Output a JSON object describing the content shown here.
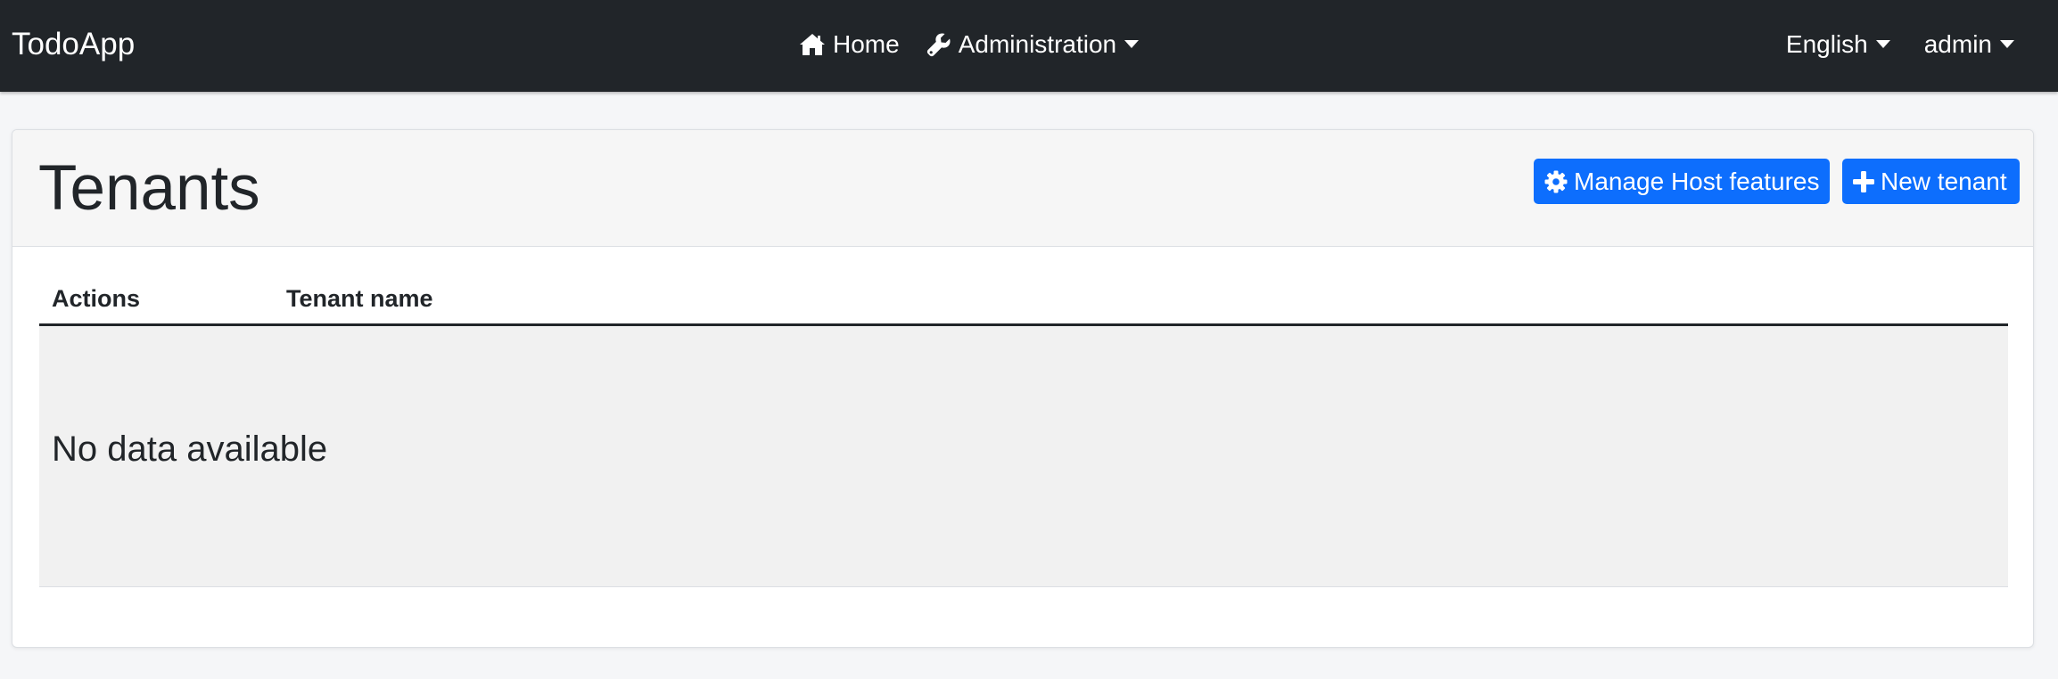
{
  "navbar": {
    "brand": "TodoApp",
    "home_label": "Home",
    "home_icon": "home-icon",
    "administration_label": "Administration",
    "administration_icon": "wrench-icon",
    "language_label": "English",
    "user_label": "admin"
  },
  "page": {
    "title": "Tenants",
    "manage_features_label": "Manage Host features",
    "manage_features_icon": "gear-icon",
    "new_tenant_label": "New tenant",
    "new_tenant_icon": "plus-icon"
  },
  "table": {
    "columns": [
      "Actions",
      "Tenant name"
    ],
    "rows": [],
    "empty_message": "No data available"
  },
  "colors": {
    "navbar_bg": "#212529",
    "primary": "#0d6efd",
    "page_bg": "#f5f6f8"
  }
}
